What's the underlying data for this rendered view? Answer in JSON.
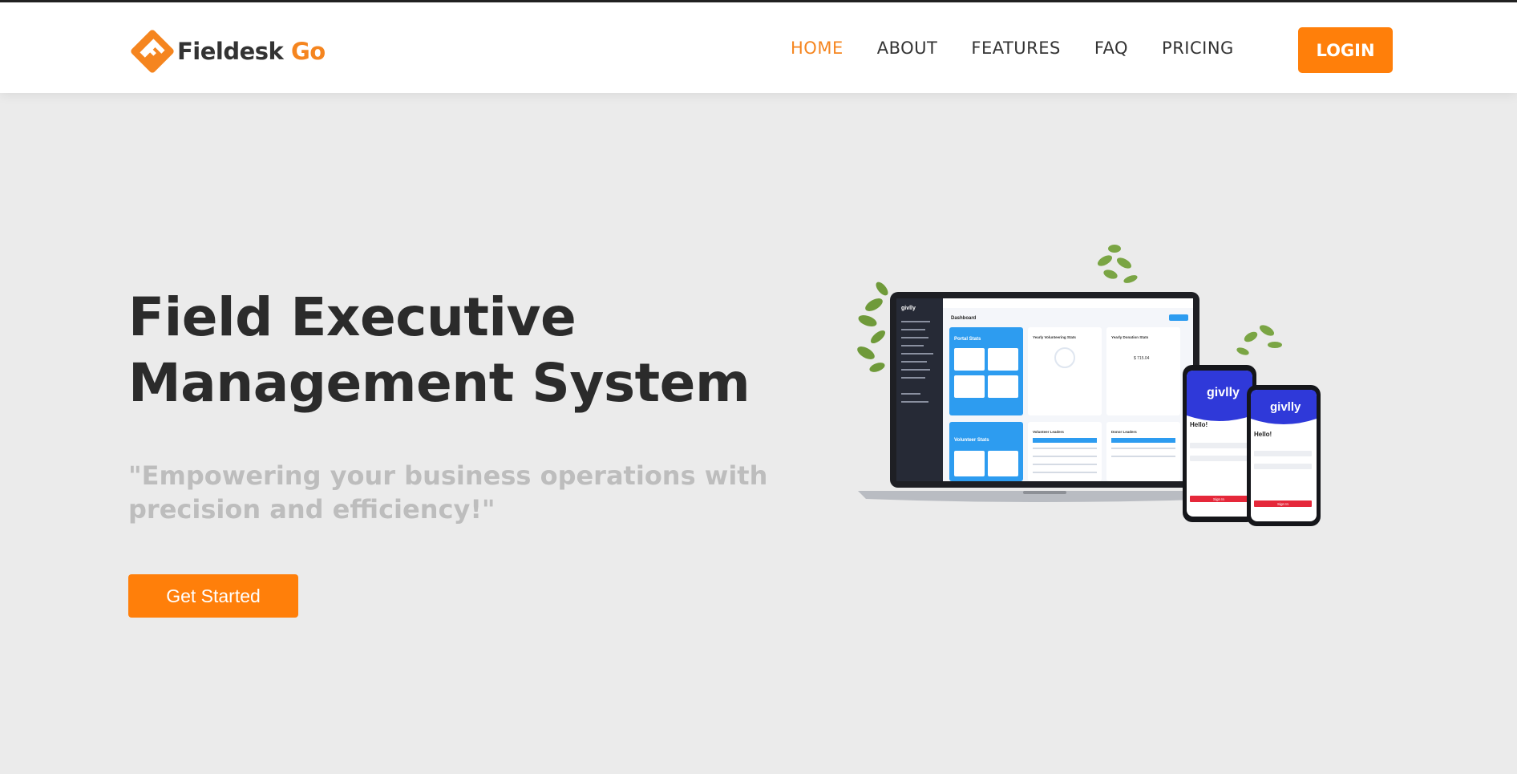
{
  "brand": {
    "name": "Fieldesk",
    "suffix": "Go",
    "accent": "#f5851f"
  },
  "nav": {
    "items": [
      {
        "label": "HOME",
        "active": true
      },
      {
        "label": "ABOUT",
        "active": false
      },
      {
        "label": "FEATURES",
        "active": false
      },
      {
        "label": "FAQ",
        "active": false
      },
      {
        "label": "PRICING",
        "active": false
      }
    ],
    "login_label": "LOGIN"
  },
  "hero": {
    "title_line1": "Field Executive",
    "title_line2": "Management System",
    "subtitle": "\"Empowering your business operations with precision and efficiency!\"",
    "cta_label": "Get Started"
  },
  "mockup": {
    "app_name": "givlly",
    "dashboard_title": "Dashboard",
    "portal_stats": "Portal Stats",
    "volunteer_stats": "Volunteer Stats",
    "yearly_volunteering": "Yearly Volunteering Stats",
    "yearly_donation": "Yearly Donation Stats",
    "volunteer_leaders": "Volunteer Leaders",
    "donor_leaders": "Donor Leaders",
    "donation_amount": "$ 715.04",
    "phone_greeting": "Hello!",
    "phone_button": "Sign In"
  },
  "colors": {
    "primary_orange": "#ff7f0a",
    "heading": "#2b2b2b",
    "subtitle": "#bdbdbd",
    "background": "#ebebeb"
  }
}
